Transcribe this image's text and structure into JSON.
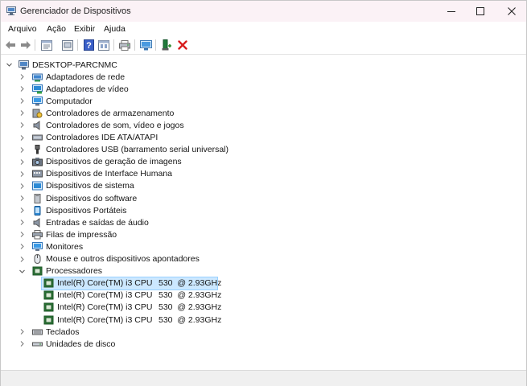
{
  "window": {
    "title": "Gerenciador de Dispositivos",
    "minimize_icon": "minimize-icon",
    "maximize_icon": "maximize-icon",
    "close_icon": "close-icon"
  },
  "menu": [
    "Arquivo",
    "Ação",
    "Exibir",
    "Ajuda"
  ],
  "toolbar_icons": [
    "back-arrow-icon",
    "forward-arrow-icon",
    "properties-icon",
    "update-driver-icon",
    "help-icon",
    "view-icon",
    "print-icon",
    "scan-hardware-icon",
    "enable-device-icon",
    "uninstall-icon"
  ],
  "tree": {
    "root": "DESKTOP-PARCNMC",
    "categories": [
      {
        "label": "Adaptadores de rede",
        "icon": "network-adapter-icon"
      },
      {
        "label": "Adaptadores de vídeo",
        "icon": "display-adapter-icon"
      },
      {
        "label": "Computador",
        "icon": "computer-icon"
      },
      {
        "label": "Controladores de armazenamento",
        "icon": "storage-controller-icon"
      },
      {
        "label": "Controladores de som, vídeo e jogos",
        "icon": "speaker-icon"
      },
      {
        "label": "Controladores IDE ATA/ATAPI",
        "icon": "ide-controller-icon"
      },
      {
        "label": "Controladores USB (barramento serial universal)",
        "icon": "usb-icon"
      },
      {
        "label": "Dispositivos de geração de imagens",
        "icon": "camera-icon"
      },
      {
        "label": "Dispositivos de Interface Humana",
        "icon": "hid-icon"
      },
      {
        "label": "Dispositivos de sistema",
        "icon": "system-device-icon"
      },
      {
        "label": "Dispositivos do software",
        "icon": "software-device-icon"
      },
      {
        "label": "Dispositivos Portáteis",
        "icon": "portable-device-icon"
      },
      {
        "label": "Entradas e saídas de áudio",
        "icon": "audio-io-icon"
      },
      {
        "label": "Filas de impressão",
        "icon": "printer-icon"
      },
      {
        "label": "Monitores",
        "icon": "monitor-icon"
      },
      {
        "label": "Mouse e outros dispositivos apontadores",
        "icon": "mouse-icon"
      },
      {
        "label": "Processadores",
        "icon": "processor-icon",
        "expanded": true
      }
    ],
    "processors": [
      {
        "name": "Intel(R) Core(TM) i3 CPU",
        "speed": "530  @ 2.93GHz",
        "selected": true
      },
      {
        "name": "Intel(R) Core(TM) i3 CPU",
        "speed": "530  @ 2.93GHz"
      },
      {
        "name": "Intel(R) Core(TM) i3 CPU",
        "speed": "530  @ 2.93GHz"
      },
      {
        "name": "Intel(R) Core(TM) i3 CPU",
        "speed": "530  @ 2.93GHz"
      }
    ],
    "after": [
      {
        "label": "Teclados",
        "icon": "keyboard-icon"
      },
      {
        "label": "Unidades de disco",
        "icon": "disk-drive-icon"
      }
    ]
  },
  "colors": {
    "titlebar": "#fbf2f6",
    "selection": "#cce8ff",
    "uninstall_red": "#d81e1e",
    "help_blue": "#3a5fc8"
  }
}
